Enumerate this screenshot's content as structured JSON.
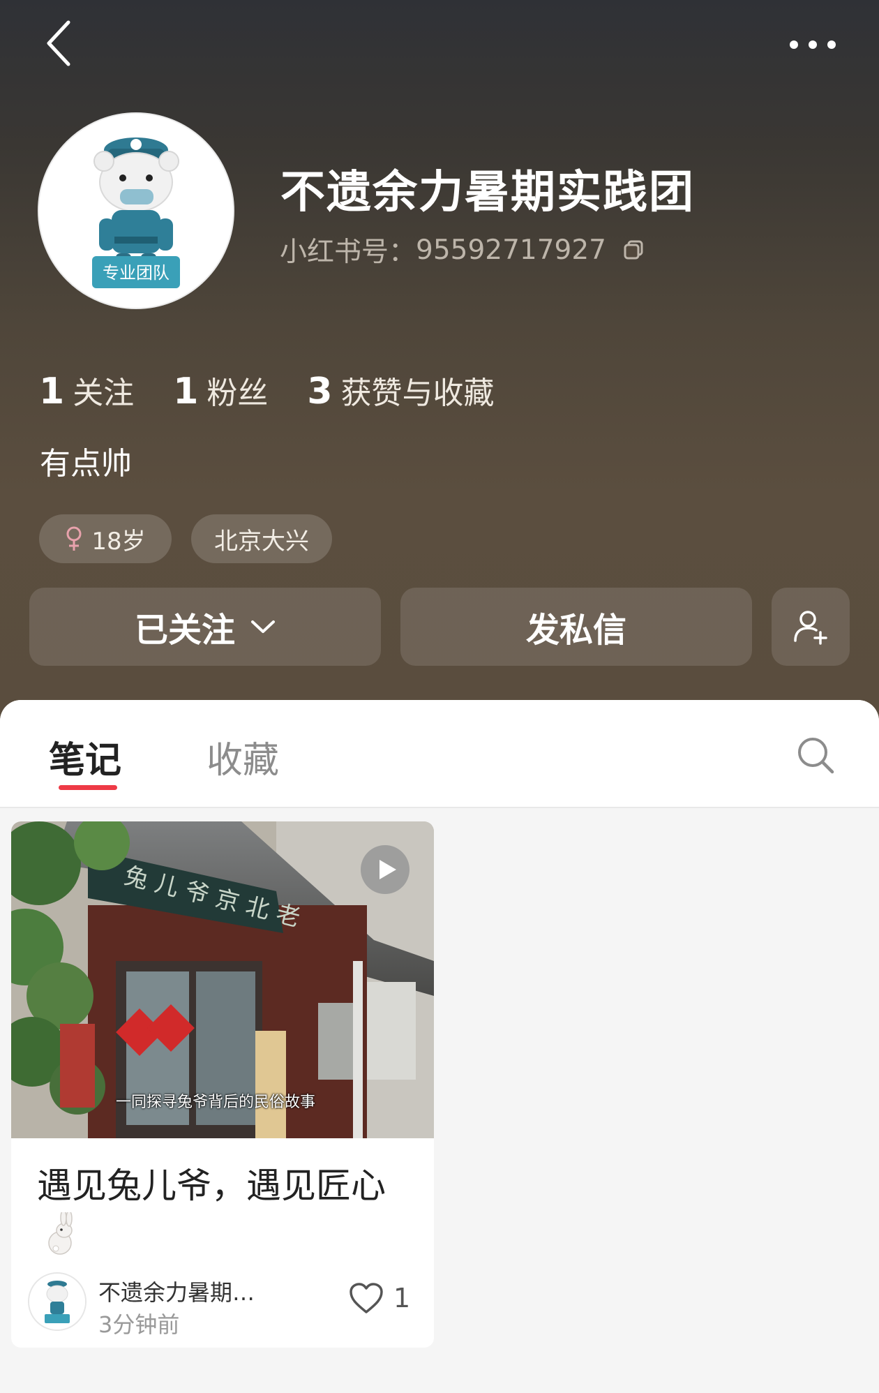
{
  "colors": {
    "accent_red": "#ee3a46",
    "header_top": "#2f3136",
    "header_bottom": "#5a4d3e",
    "avatar_teal": "#2f8fa6"
  },
  "header": {
    "back_icon": "chevron-left-icon",
    "more_icon": "more-horizontal-icon"
  },
  "profile": {
    "name": "不遗余力暑期实践团",
    "avatar_badge": "专业团队",
    "xhs_id_label": "小红书号：",
    "xhs_id": "95592717927",
    "bio": "有点帅",
    "stats": [
      {
        "num": "1",
        "label": "关注"
      },
      {
        "num": "1",
        "label": "粉丝"
      },
      {
        "num": "3",
        "label": "获赞与收藏"
      }
    ],
    "tags": {
      "age": "18岁",
      "gender_icon": "female-icon",
      "location": "北京大兴"
    }
  },
  "actions": {
    "following_label": "已关注",
    "message_label": "发私信",
    "add_user_icon": "add-user-icon"
  },
  "tabs": [
    {
      "label": "笔记",
      "active": true
    },
    {
      "label": "收藏",
      "active": false
    }
  ],
  "notes": [
    {
      "title": "遇见兔儿爷，遇见匠心",
      "cover_caption": "一同探寻兔爷背后的民俗故事",
      "author": "不遗余力暑期…",
      "time": "3分钟前",
      "likes": "1",
      "is_video": true
    }
  ]
}
